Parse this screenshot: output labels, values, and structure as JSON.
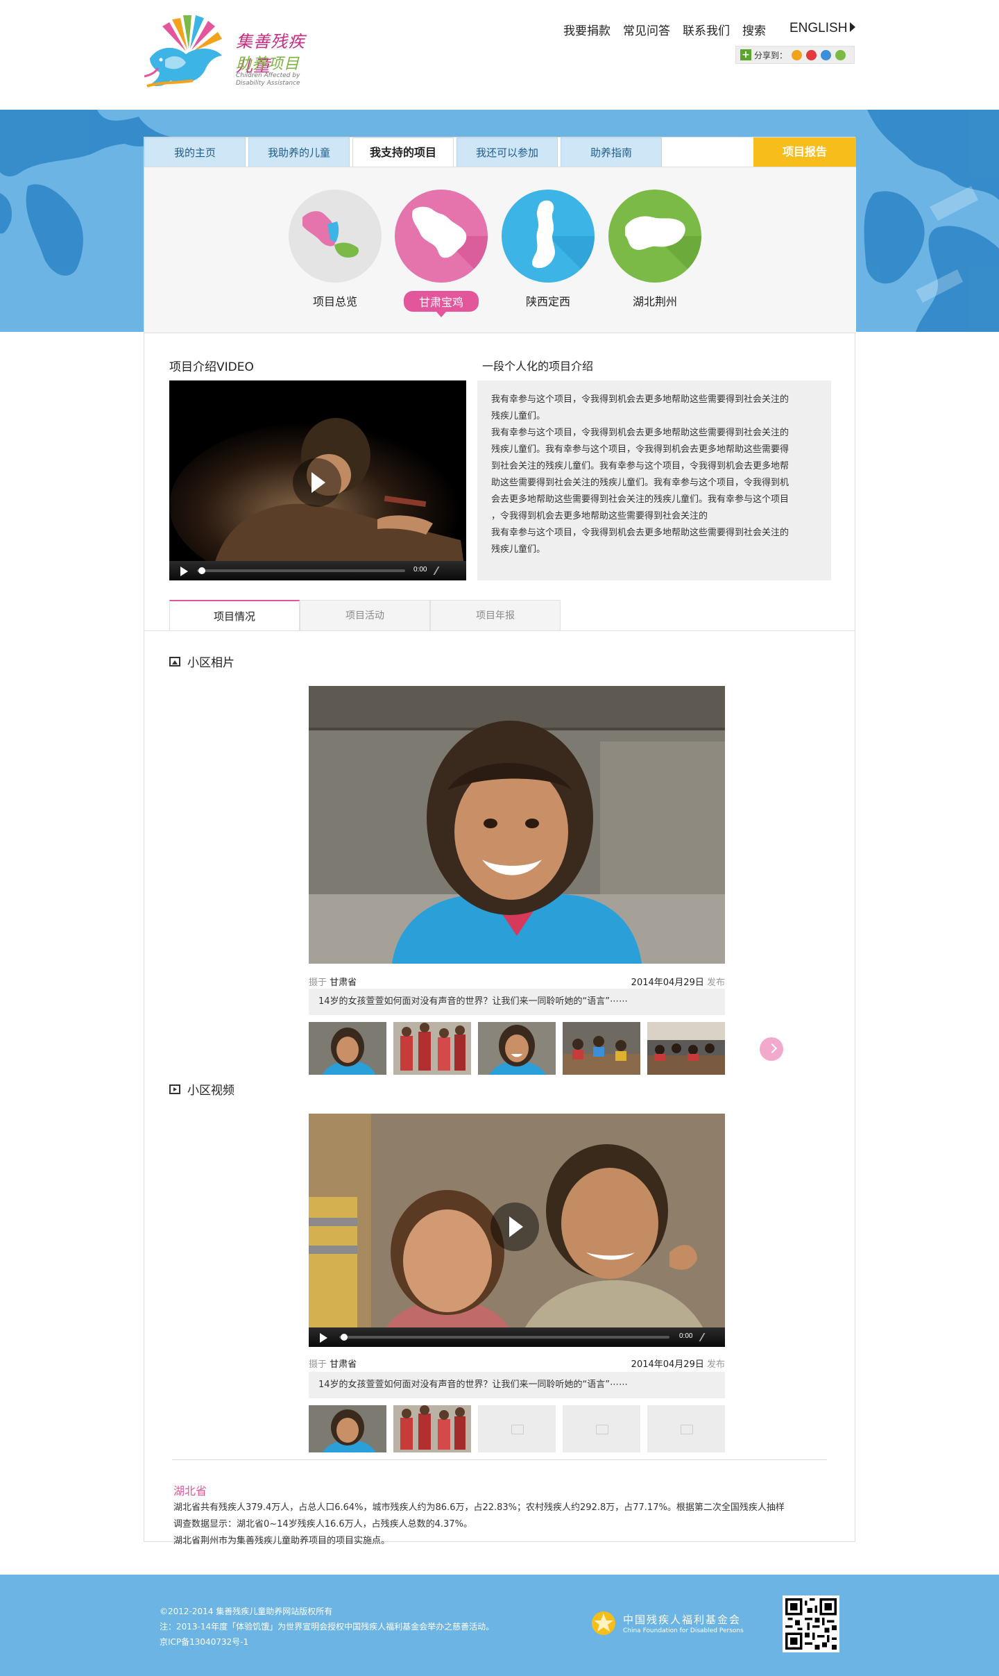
{
  "logo": {
    "cn_line1": "集善残疾儿童",
    "cn_line2": "助养项目",
    "en_line": "Children Affected by Disability Assistance"
  },
  "topnav": {
    "items": [
      "我要捐款",
      "常见问答",
      "联系我们",
      "搜索"
    ],
    "english": "ENGLISH",
    "share_label": "分享到："
  },
  "tabs": {
    "items": [
      "我的主页",
      "我助养的儿童",
      "我支持的项目",
      "我还可以参加",
      "助养指南"
    ],
    "report": "项目报告"
  },
  "projects": [
    {
      "label": "项目总览",
      "color": "#e4e4e4"
    },
    {
      "label": "甘肃宝鸡",
      "color": "#e574ad"
    },
    {
      "label": "陕西定西",
      "color": "#3cb4e6"
    },
    {
      "label": "湖北荆州",
      "color": "#7cba48"
    }
  ],
  "video_section": {
    "title": "项目介绍VIDEO",
    "time": "0:00"
  },
  "intro_section": {
    "title": "一段个人化的项目介绍",
    "lines": [
      "我有幸参与这个项目，令我得到机会去更多地帮助这些需要得到社会关注的",
      "残疾儿童们。",
      "我有幸参与这个项目，令我得到机会去更多地帮助这些需要得到社会关注的",
      "残疾儿童们。我有幸参与这个项目，令我得到机会去更多地帮助这些需要得",
      "到社会关注的残疾儿童们。我有幸参与这个项目，令我得到机会去更多地帮",
      "助这些需要得到社会关注的残疾儿童们。我有幸参与这个项目，令我得到机",
      "会去更多地帮助这些需要得到社会关注的残疾儿童们。我有幸参与这个项目",
      "，令我得到机会去更多地帮助这些需要得到社会关注的",
      "我有幸参与这个项目，令我得到机会去更多地帮助这些需要得到社会关注的",
      "残疾儿童们。"
    ]
  },
  "project_tabs": [
    "项目情况",
    "项目活动",
    "项目年报"
  ],
  "photos": {
    "title": "小区相片",
    "taken_prefix": "摄于",
    "location": "甘肃省",
    "date": "2014年04月29日",
    "publish": "发布",
    "caption": "14岁的女孩萱萱如何面对没有声音的世界？让我们来一同聆听她的“语言”⋯⋯"
  },
  "videos": {
    "title": "小区视频",
    "taken_prefix": "摄于",
    "location": "甘肃省",
    "date": "2014年04月29日",
    "publish": "发布",
    "caption": "14岁的女孩萱萱如何面对没有声音的世界？让我们来一同聆听她的“语言”⋯⋯",
    "time": "0:00"
  },
  "province": {
    "name": "湖北省",
    "lines": [
      "湖北省共有残疾人379.4万人，占总人口6.64%，城市残疾人约为86.6万，占22.83%；农村残疾人约292.8万，占77.17%。根据第二次全国残疾人抽样",
      "调查数据显示：湖北省0~14岁残疾人16.6万人，占残疾人总数的4.37%。",
      "湖北省荆州市为集善残疾儿童助养项目的项目实施点。"
    ]
  },
  "footer": {
    "lines": [
      "©2012-2014 集善残疾儿童助养网站版权所有",
      "注：2013-14年度「体验饥饿」为世界宣明会授权中国残疾人福利基金会举办之慈善活动。",
      "京ICP备13040732号-1"
    ],
    "org_cn": "中国残疾人福利基金会",
    "org_en": "China Foundation for Disabled Persons"
  },
  "colors": {
    "accent_pink": "#e3569b",
    "sky_blue": "#6cb4e4",
    "report_yellow": "#f7bd1b"
  }
}
